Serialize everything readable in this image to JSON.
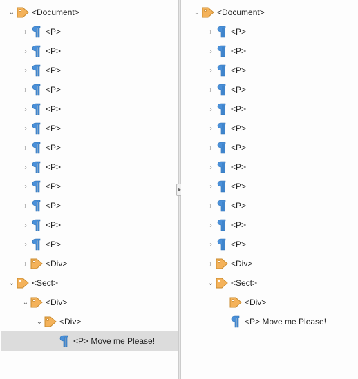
{
  "icons": {
    "tag": "tag-icon",
    "pilcrow": "pilcrow-icon"
  },
  "colors": {
    "tag_fill": "#f4b25a",
    "tag_ring": "#c98a2e",
    "pilcrow": "#4a90d9",
    "pilcrow_dark": "#2a6db0"
  },
  "twisty": {
    "expanded": "⌄",
    "collapsed": "›"
  },
  "left": {
    "root": {
      "label": "<Document>",
      "icon": "tag",
      "twisty": "expanded",
      "depth": 0,
      "selected": false,
      "children": [
        {
          "label": "<P>",
          "icon": "pilcrow",
          "twisty": "collapsed",
          "depth": 1
        },
        {
          "label": "<P>",
          "icon": "pilcrow",
          "twisty": "collapsed",
          "depth": 1
        },
        {
          "label": "<P>",
          "icon": "pilcrow",
          "twisty": "collapsed",
          "depth": 1
        },
        {
          "label": "<P>",
          "icon": "pilcrow",
          "twisty": "collapsed",
          "depth": 1
        },
        {
          "label": "<P>",
          "icon": "pilcrow",
          "twisty": "collapsed",
          "depth": 1
        },
        {
          "label": "<P>",
          "icon": "pilcrow",
          "twisty": "collapsed",
          "depth": 1
        },
        {
          "label": "<P>",
          "icon": "pilcrow",
          "twisty": "collapsed",
          "depth": 1
        },
        {
          "label": "<P>",
          "icon": "pilcrow",
          "twisty": "collapsed",
          "depth": 1
        },
        {
          "label": "<P>",
          "icon": "pilcrow",
          "twisty": "collapsed",
          "depth": 1
        },
        {
          "label": "<P>",
          "icon": "pilcrow",
          "twisty": "collapsed",
          "depth": 1
        },
        {
          "label": "<P>",
          "icon": "pilcrow",
          "twisty": "collapsed",
          "depth": 1
        },
        {
          "label": "<P>",
          "icon": "pilcrow",
          "twisty": "collapsed",
          "depth": 1
        },
        {
          "label": "<Div>",
          "icon": "tag",
          "twisty": "collapsed",
          "depth": 1
        }
      ]
    },
    "sect": {
      "label": "<Sect>",
      "icon": "tag",
      "twisty": "expanded",
      "depth": 0,
      "children": [
        {
          "label": "<Div>",
          "icon": "tag",
          "twisty": "expanded",
          "depth": 1,
          "children": [
            {
              "label": "<Div>",
              "icon": "tag",
              "twisty": "expanded",
              "depth": 2,
              "children": [
                {
                  "label": "<P> Move me Please!",
                  "icon": "pilcrow",
                  "twisty": "none",
                  "depth": 3,
                  "selected": true
                }
              ]
            }
          ]
        }
      ]
    }
  },
  "right": {
    "root": {
      "label": "<Document>",
      "icon": "tag",
      "twisty": "expanded",
      "depth": 0,
      "selected": false,
      "children": [
        {
          "label": "<P>",
          "icon": "pilcrow",
          "twisty": "collapsed",
          "depth": 1
        },
        {
          "label": "<P>",
          "icon": "pilcrow",
          "twisty": "collapsed",
          "depth": 1
        },
        {
          "label": "<P>",
          "icon": "pilcrow",
          "twisty": "collapsed",
          "depth": 1
        },
        {
          "label": "<P>",
          "icon": "pilcrow",
          "twisty": "collapsed",
          "depth": 1
        },
        {
          "label": "<P>",
          "icon": "pilcrow",
          "twisty": "collapsed",
          "depth": 1
        },
        {
          "label": "<P>",
          "icon": "pilcrow",
          "twisty": "collapsed",
          "depth": 1
        },
        {
          "label": "<P>",
          "icon": "pilcrow",
          "twisty": "collapsed",
          "depth": 1
        },
        {
          "label": "<P>",
          "icon": "pilcrow",
          "twisty": "collapsed",
          "depth": 1
        },
        {
          "label": "<P>",
          "icon": "pilcrow",
          "twisty": "collapsed",
          "depth": 1
        },
        {
          "label": "<P>",
          "icon": "pilcrow",
          "twisty": "collapsed",
          "depth": 1
        },
        {
          "label": "<P>",
          "icon": "pilcrow",
          "twisty": "collapsed",
          "depth": 1
        },
        {
          "label": "<P>",
          "icon": "pilcrow",
          "twisty": "collapsed",
          "depth": 1
        },
        {
          "label": "<Div>",
          "icon": "tag",
          "twisty": "collapsed",
          "depth": 1
        },
        {
          "label": "<Sect>",
          "icon": "tag",
          "twisty": "expanded",
          "depth": 1,
          "children": [
            {
              "label": "<Div>",
              "icon": "tag",
              "twisty": "none",
              "depth": 2
            },
            {
              "label": "<P>  Move me Please!",
              "icon": "pilcrow",
              "twisty": "none",
              "depth": 2
            }
          ]
        }
      ]
    }
  }
}
